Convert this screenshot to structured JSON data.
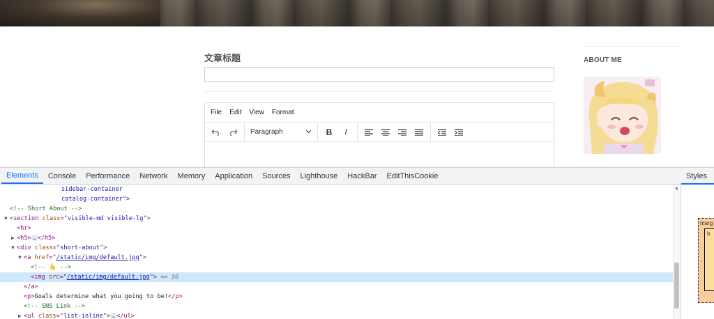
{
  "page": {
    "article_title_label": "文章标题",
    "title_input_value": "",
    "editor": {
      "menu": [
        "File",
        "Edit",
        "View",
        "Format"
      ],
      "block_format": "Paragraph"
    },
    "sidebar": {
      "about_label": "ABOUT ME"
    }
  },
  "devtools": {
    "tabs": [
      "Elements",
      "Console",
      "Performance",
      "Network",
      "Memory",
      "Application",
      "Sources",
      "Lighthouse",
      "HackBar",
      "EditThisCookie"
    ],
    "active_tab": "Elements",
    "styles_tab": "Styles",
    "box_model": {
      "margin_label": "marg",
      "border_label": "b",
      "dash": "-"
    },
    "dom": {
      "l1": "sidebar-container",
      "l2": "catalog-container\">",
      "short_about_comment": "<!-- Short About -->",
      "section_tag": "section",
      "section_attr": "class",
      "section_val": "visible-md visible-lg",
      "hr": "<hr>",
      "h5_open": "<h5>",
      "h5_close": "</h5>",
      "ellipsis": "…",
      "div_tag": "div",
      "div_attr": "class",
      "div_val": "short-about",
      "a_tag": "a",
      "a_attr": "href",
      "a_val": "/static/img/default.jpg",
      "emoji_comment_open": "<!-- ",
      "emoji": "👆",
      "emoji_comment_close": " -->",
      "img_tag": "img",
      "img_attr": "src",
      "img_val": "/static/img/default.jpg",
      "selected_marker": "== $0",
      "a_close": "</a>",
      "p_text": "Goals determine what you going to be!",
      "sns_comment": "<!-- SNS Link -->",
      "ul_tag": "ul",
      "ul_attr": "class",
      "ul_val": "list-inline",
      "ul_close": "</ul>"
    }
  },
  "colors": {
    "devtools_accent": "#1a73e8",
    "tag": "#881280",
    "attr": "#994500",
    "value": "#1a1aa6",
    "comment": "#236e25",
    "selected_row": "#cfe8fc"
  }
}
